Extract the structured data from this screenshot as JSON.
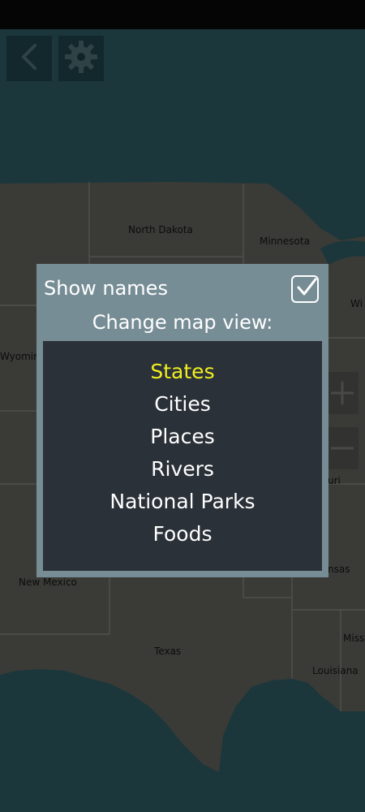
{
  "top_buttons": {
    "back_icon": "chevron-left-icon",
    "settings_icon": "gear-icon"
  },
  "map": {
    "labels": {
      "north_dakota": "North Dakota",
      "minnesota": "Minnesota",
      "wisconsin": "Wi",
      "wyoming": "Wyomin",
      "missouri": "uri",
      "arkansas": "nsas",
      "new_mexico": "New Mexico",
      "texas": "Texas",
      "mississippi": "Miss",
      "louisiana": "Louisiana"
    }
  },
  "dialog": {
    "show_names_label": "Show names",
    "show_names_checked": true,
    "change_view_label": "Change map view:",
    "options": [
      {
        "label": "States",
        "selected": true
      },
      {
        "label": "Cities",
        "selected": false
      },
      {
        "label": "Places",
        "selected": false
      },
      {
        "label": "Rivers",
        "selected": false
      },
      {
        "label": "National Parks",
        "selected": false
      },
      {
        "label": "Foods",
        "selected": false
      }
    ],
    "selected_color": "#f0ef20"
  },
  "colors": {
    "land": "#62615d",
    "water": "#2d5c63",
    "state_line": "#8a8a86"
  }
}
